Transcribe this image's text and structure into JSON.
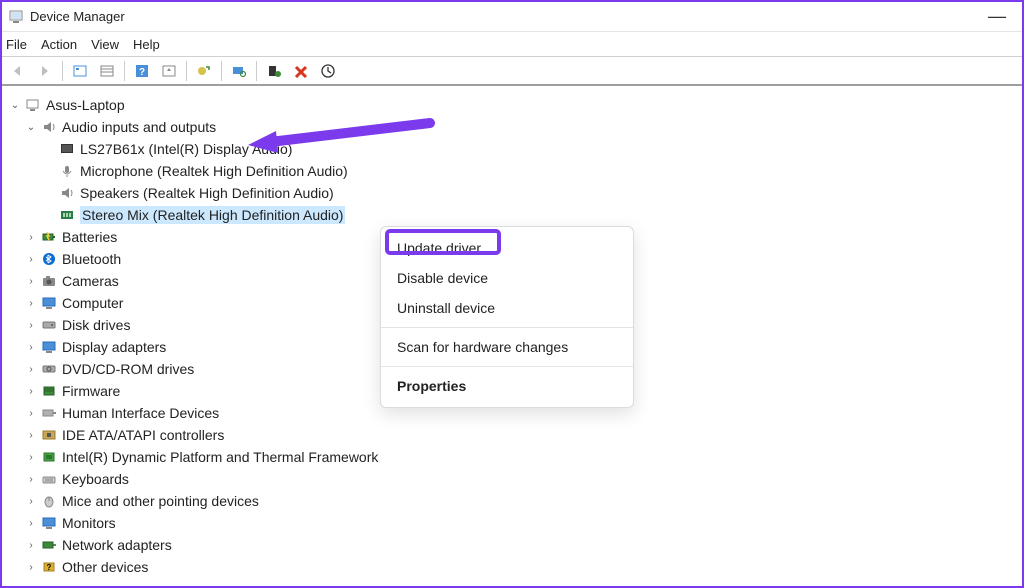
{
  "window": {
    "title": "Device Manager"
  },
  "menu": {
    "file": "File",
    "action": "Action",
    "view": "View",
    "help": "Help"
  },
  "tree": {
    "root": "Asus-Laptop",
    "audio": {
      "label": "Audio inputs and outputs",
      "children": {
        "display_audio": "LS27B61x (Intel(R) Display Audio)",
        "microphone": "Microphone (Realtek High Definition Audio)",
        "speakers": "Speakers (Realtek High Definition Audio)",
        "stereo_mix": "Stereo Mix (Realtek High Definition Audio)"
      }
    },
    "batteries": "Batteries",
    "bluetooth": "Bluetooth",
    "cameras": "Cameras",
    "computer": "Computer",
    "disk_drives": "Disk drives",
    "display_adapters": "Display adapters",
    "dvd": "DVD/CD-ROM drives",
    "firmware": "Firmware",
    "hid": "Human Interface Devices",
    "ide": "IDE ATA/ATAPI controllers",
    "intel_dptf": "Intel(R) Dynamic Platform and Thermal Framework",
    "keyboards": "Keyboards",
    "mice": "Mice and other pointing devices",
    "monitors": "Monitors",
    "network": "Network adapters",
    "other": "Other devices"
  },
  "context": {
    "update": "Update driver",
    "disable": "Disable device",
    "uninstall": "Uninstall device",
    "scan": "Scan for hardware changes",
    "properties": "Properties"
  },
  "annotations": {
    "highlight_target": "Update driver",
    "arrow_target": "Audio inputs and outputs"
  }
}
